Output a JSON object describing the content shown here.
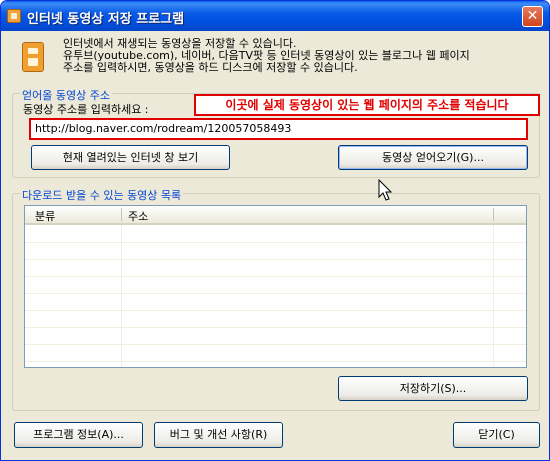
{
  "window": {
    "title": "인터넷 동영상 저장 프로그램",
    "close_symbol": "✕"
  },
  "intro": {
    "line1": "인터넷에서 재생되는 동영상을 저장할 수 있습니다.",
    "line2": "유투브(youtube.com), 네이버, 다음TV팟 등 인터넷 동영상이 있는 블로그나 웹 페이지",
    "line3": "주소를 입력하시면, 동영상을 하드 디스크에 저장할 수 있습니다."
  },
  "fetch_group": {
    "label": "얻어올 동영상 주소",
    "field_label": "동영상 주소를 입력하세요 :",
    "callout": "이곳에 실제 동영상이 있는 웹 페이지의 주소를 적습니다",
    "url_value": "http://blog.naver.com/rodream/120057058493",
    "view_browser_button": "현재 열려있는 인터넷 창 보기",
    "fetch_button": "동영상 얻어오기(G)..."
  },
  "download_group": {
    "label": "다운로드 받을 수 있는 동영상 목록",
    "columns": [
      "분류",
      "주소"
    ],
    "rows": [],
    "save_button": "저장하기(S)..."
  },
  "bottom_buttons": {
    "program_info": "프로그램 정보(A)...",
    "bug_report": "버그 및 개선 사항(R)",
    "close": "닫기(C)"
  },
  "colors": {
    "title_bar": "#0a5be6",
    "group_label": "#0046d5",
    "highlight": "#e00000",
    "window_bg": "#ece9d8"
  }
}
